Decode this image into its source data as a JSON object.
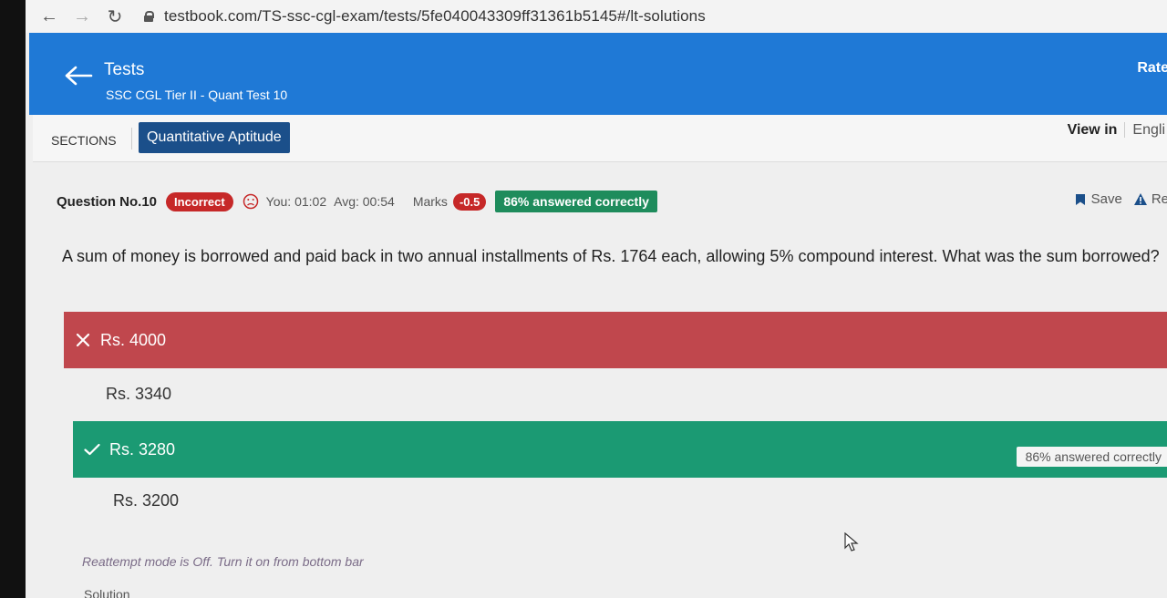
{
  "browser": {
    "url": "testbook.com/TS-ssc-cgl-exam/tests/5fe040043309ff31361b5145#/lt-solutions"
  },
  "header": {
    "title": "Tests",
    "subtitle": "SSC CGL Tier II - Quant Test 10",
    "rate": "Rate",
    "bg_color": "#1f79d6"
  },
  "sections": {
    "label": "SECTIONS",
    "active_tab": "Quantitative Aptitude",
    "view_in_label": "View in",
    "view_in_lang": "Engli"
  },
  "question_meta": {
    "number": "Question No.10",
    "status": "Incorrect",
    "you_time": "You: 01:02",
    "avg_time": "Avg: 00:54",
    "marks_label": "Marks",
    "marks": "-0.5",
    "answered_pct": "86% answered correctly",
    "save": "Save",
    "report": "Re"
  },
  "question": {
    "text": "A sum of money is borrowed and paid back in two annual installments of Rs. 1764 each, allowing 5% compound interest. What was the sum borrowed?"
  },
  "options": [
    {
      "label": "Rs. 4000",
      "state": "selected-wrong"
    },
    {
      "label": "Rs. 3340",
      "state": "none"
    },
    {
      "label": "Rs. 3280",
      "state": "correct",
      "stat": "86% answered correctly"
    },
    {
      "label": "Rs. 3200",
      "state": "none"
    }
  ],
  "footer": {
    "reattempt": "Reattempt mode is Off. Turn it on from bottom bar",
    "solution": "Solution"
  },
  "colors": {
    "wrong": "#c0474d",
    "correct": "#1b9a73",
    "badge_red": "#c62828",
    "badge_green": "#1e8c5c",
    "tab_blue": "#1b4f8a"
  }
}
